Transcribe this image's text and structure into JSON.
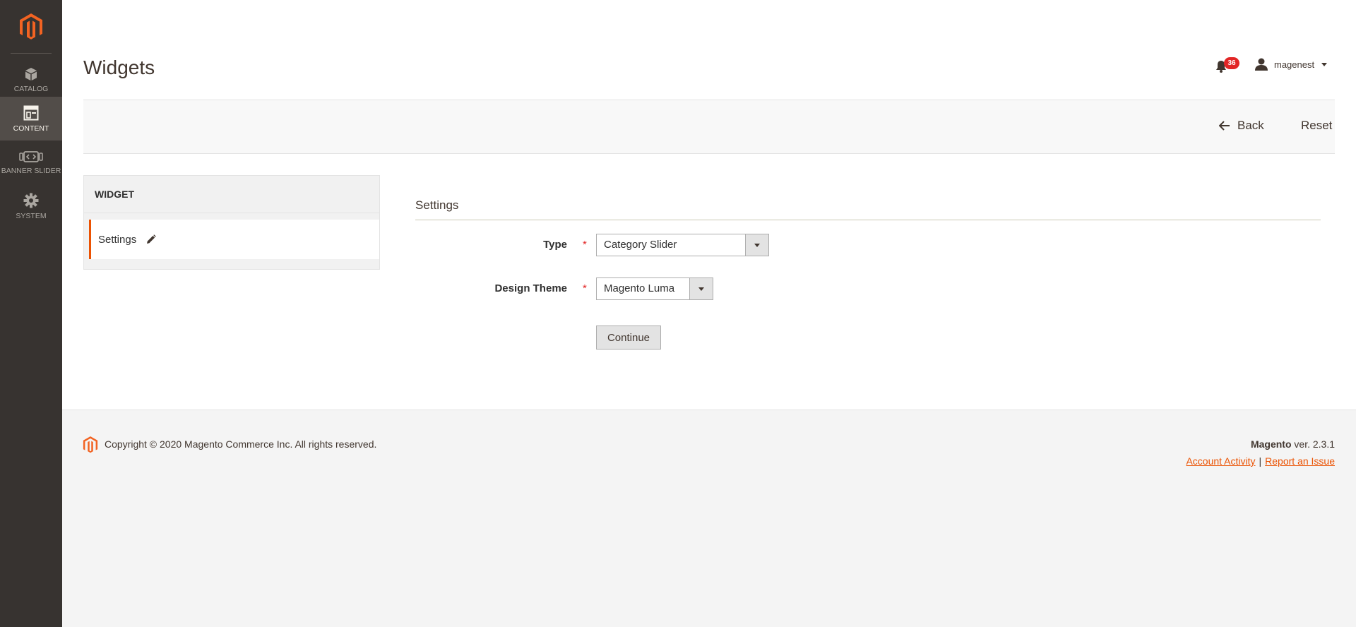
{
  "sidebar": {
    "items": [
      {
        "label": "CATALOG",
        "icon": "catalog-icon",
        "active": false
      },
      {
        "label": "CONTENT",
        "icon": "content-icon",
        "active": true
      },
      {
        "label": "BANNER SLIDER",
        "icon": "banner-slider-icon",
        "active": false
      },
      {
        "label": "SYSTEM",
        "icon": "gear-icon",
        "active": false
      }
    ]
  },
  "header": {
    "title": "Widgets",
    "notifications_count": "36",
    "user_name": "magenest"
  },
  "actions": {
    "back_label": "Back",
    "reset_label": "Reset"
  },
  "tabs": {
    "heading": "WIDGET",
    "items": [
      {
        "label": "Settings"
      }
    ]
  },
  "form": {
    "section_title": "Settings",
    "type": {
      "label": "Type",
      "value": "Category Slider"
    },
    "design_theme": {
      "label": "Design Theme",
      "value": "Magento Luma"
    },
    "continue_label": "Continue",
    "required_mark": "*"
  },
  "footer": {
    "copyright": "Copyright © 2020 Magento Commerce Inc. All rights reserved.",
    "brand": "Magento",
    "version": "ver. 2.3.1",
    "account_activity": "Account Activity",
    "separator": "|",
    "report_issue": "Report an Issue"
  },
  "colors": {
    "accent": "#eb5202",
    "sidebar_bg": "#373330",
    "sidebar_active": "#524d49",
    "required": "#e22626"
  }
}
